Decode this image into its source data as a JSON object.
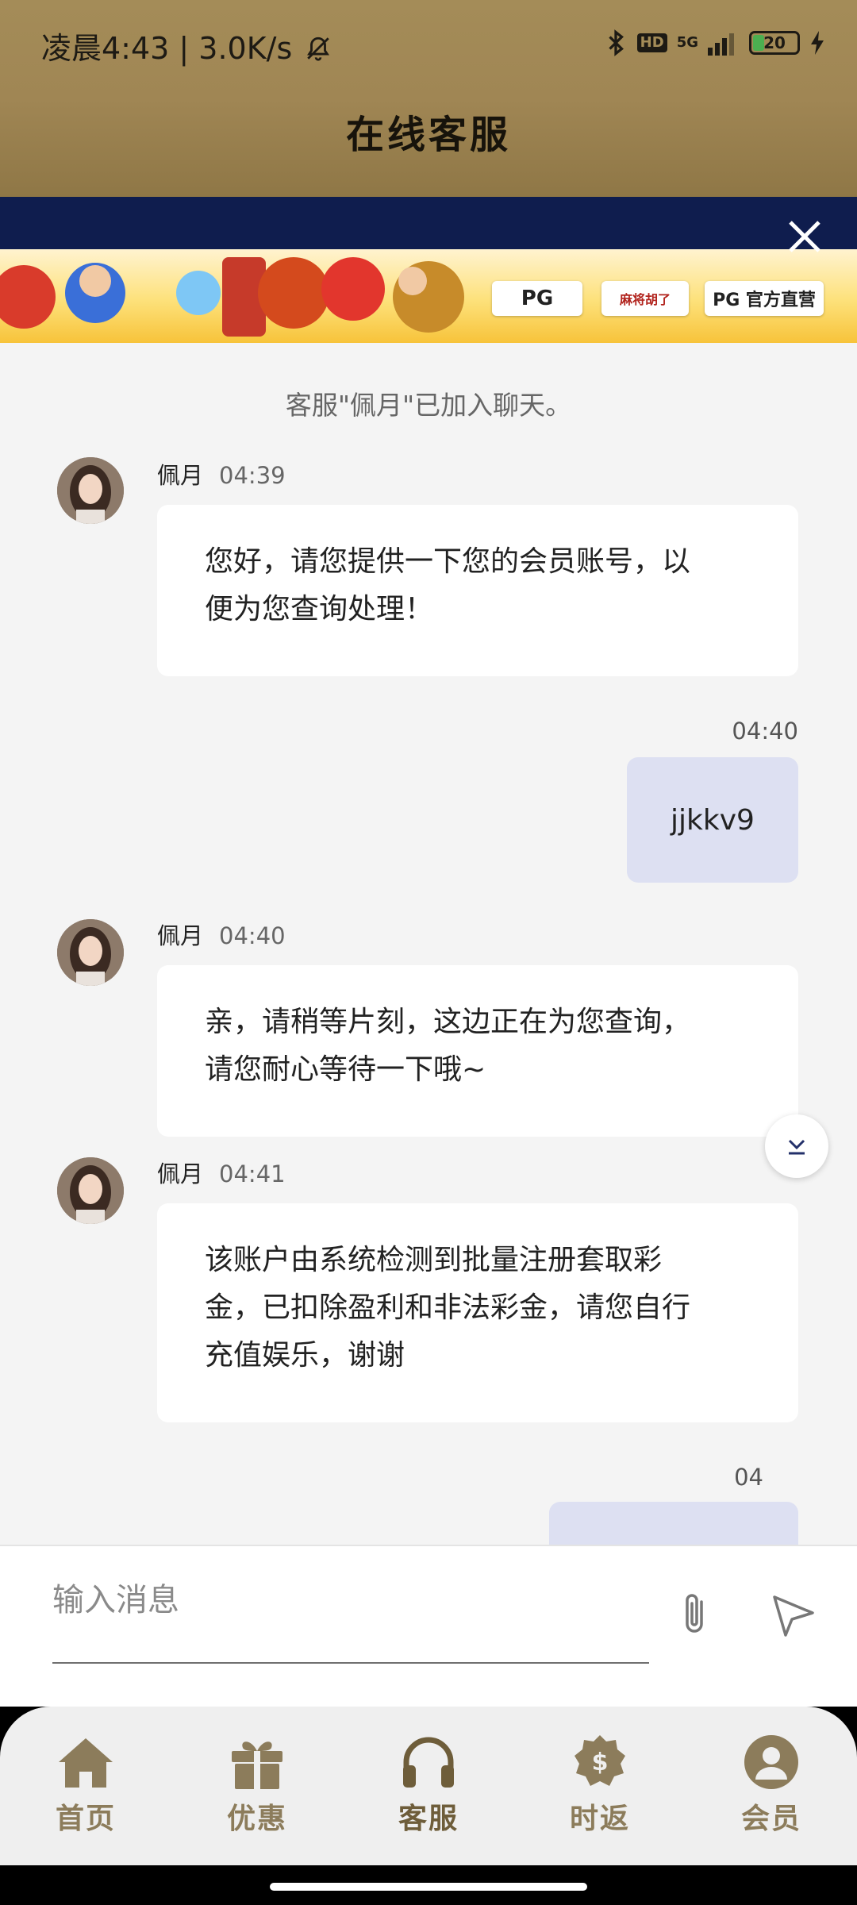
{
  "status_bar": {
    "time": "凌晨4:43 | 3.0K/s",
    "hd": "HD",
    "network": "5G",
    "battery": "20"
  },
  "header": {
    "title": "在线客服"
  },
  "banner": {
    "close_label": "✕",
    "chips": [
      "PG",
      "麻将胡了",
      "PG 官方直营"
    ]
  },
  "chat": {
    "system_message": "客服\"佩月\"已加入聊天。",
    "messages": [
      {
        "sender": "佩月",
        "time": "04:39",
        "lines": [
          "您好，请您提供一下您的会员账号，以",
          "便为您查询处理！"
        ]
      },
      {
        "time": "04:40",
        "text": "jjkkv9"
      },
      {
        "sender": "佩月",
        "time": "04:40",
        "lines": [
          "亲，请稍等片刻，这边正在为您查询，",
          "请您耐心等待一下哦~"
        ]
      },
      {
        "sender": "佩月",
        "time": "04:41",
        "lines": [
          "该账户由系统检测到批量注册套取彩",
          "金，已扣除盈利和非法彩金，请您自行",
          "充值娱乐，谢谢"
        ]
      },
      {
        "time_partial": "04"
      }
    ]
  },
  "composer": {
    "placeholder": "输入消息"
  },
  "tabbar": {
    "active": "客服",
    "items": [
      {
        "label": "首页",
        "icon": "home-icon"
      },
      {
        "label": "优惠",
        "icon": "gift-icon"
      },
      {
        "label": "客服",
        "icon": "headset-icon"
      },
      {
        "label": "时返",
        "icon": "dollar-badge-icon"
      },
      {
        "label": "会员",
        "icon": "user-icon"
      }
    ]
  },
  "colors": {
    "header_gold": "#a48c58",
    "banner_navy": "#0f1d4e",
    "tab_label": "#8c7c5b",
    "outgoing_bubble": "#dde0f2"
  }
}
